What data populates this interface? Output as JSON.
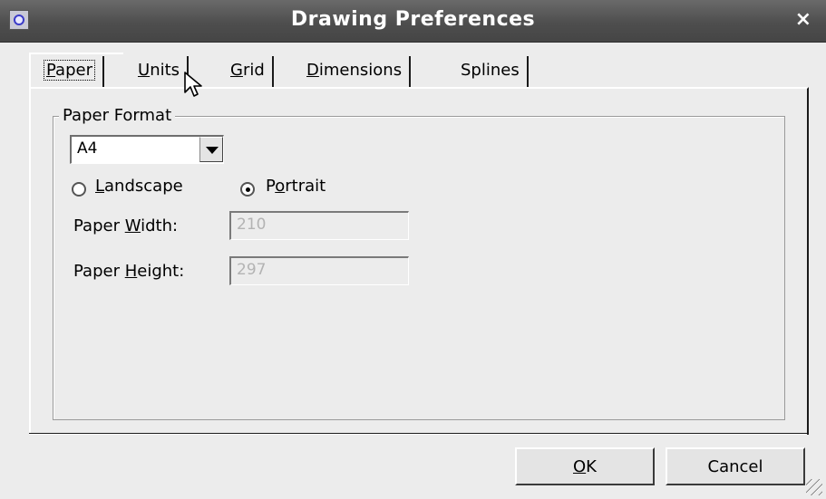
{
  "window": {
    "title": "Drawing Preferences",
    "close_glyph": "×"
  },
  "tabs": [
    {
      "mn": "P",
      "rest": "aper"
    },
    {
      "mn": "U",
      "rest": "nits"
    },
    {
      "mn": "G",
      "rest": "rid"
    },
    {
      "mn": "D",
      "rest": "imensions"
    },
    {
      "pre": "Splines"
    }
  ],
  "paper_tab": {
    "group_title": "Paper Format",
    "format_value": "A4",
    "landscape": {
      "mn": "L",
      "rest": "andscape",
      "checked": false
    },
    "portrait": {
      "pre": "P",
      "mn": "o",
      "rest": "rtrait",
      "checked": true
    },
    "width_label": {
      "pre": "Paper ",
      "mn": "W",
      "rest": "idth:"
    },
    "width_value": "210",
    "height_label": {
      "pre": "Paper ",
      "mn": "H",
      "rest": "eight:"
    },
    "height_value": "297"
  },
  "buttons": {
    "ok": {
      "mn": "O",
      "rest": "K"
    },
    "cancel": "Cancel"
  },
  "icons": {
    "app": "app-icon",
    "close": "close-icon",
    "combo_arrow": "chevron-down-icon",
    "cursor": "mouse-pointer-icon"
  }
}
